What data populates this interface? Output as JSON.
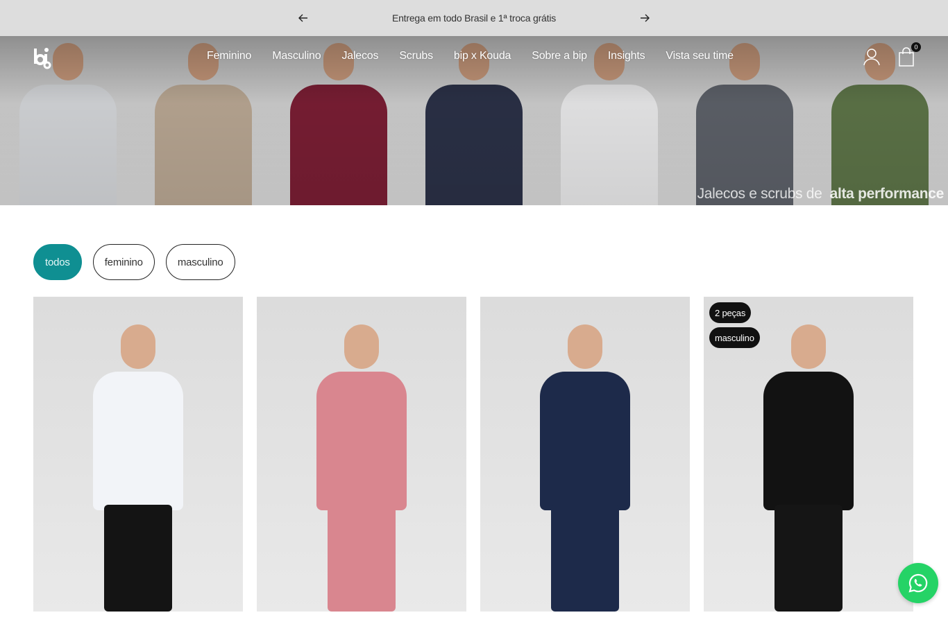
{
  "announcement": {
    "text": "Entrega em todo Brasil e 1ª troca grátis",
    "prev_icon": "arrow-left-icon",
    "next_icon": "arrow-right-icon"
  },
  "header": {
    "logo_icon": "bip-logo-icon",
    "nav": [
      "Feminino",
      "Masculino",
      "Jalecos",
      "Scrubs",
      "bip x Kouda",
      "Sobre a bip",
      "Insights",
      "Vista seu time"
    ],
    "account_icon": "user-icon",
    "cart_icon": "shopping-bag-icon",
    "cart_count": "0"
  },
  "hero": {
    "tagline_regular": "Jalecos e scrubs de",
    "tagline_bold": "alta performance",
    "panel_colors": [
      "#d4d6d9",
      "#b9a793",
      "#7a1e34",
      "#2b3147",
      "#e9e9ea",
      "#5d6169",
      "#5d7448"
    ]
  },
  "filters": {
    "items": [
      "todos",
      "feminino",
      "masculino"
    ],
    "active": "todos",
    "accent_color": "#0f8f92"
  },
  "products": [
    {
      "badges": [],
      "top_color": "#f2f4f8",
      "bottom_color": "#141414"
    },
    {
      "badges": [],
      "top_color": "#d9868f",
      "bottom_color": "#d9868f"
    },
    {
      "badges": [],
      "top_color": "#1d2a4a",
      "bottom_color": "#1d2a4a"
    },
    {
      "badges": [
        "2 peças",
        "masculino"
      ],
      "top_color": "#121212",
      "bottom_color": "#151515"
    }
  ],
  "floating": {
    "whatsapp_icon": "whatsapp-icon",
    "color": "#25d366"
  }
}
